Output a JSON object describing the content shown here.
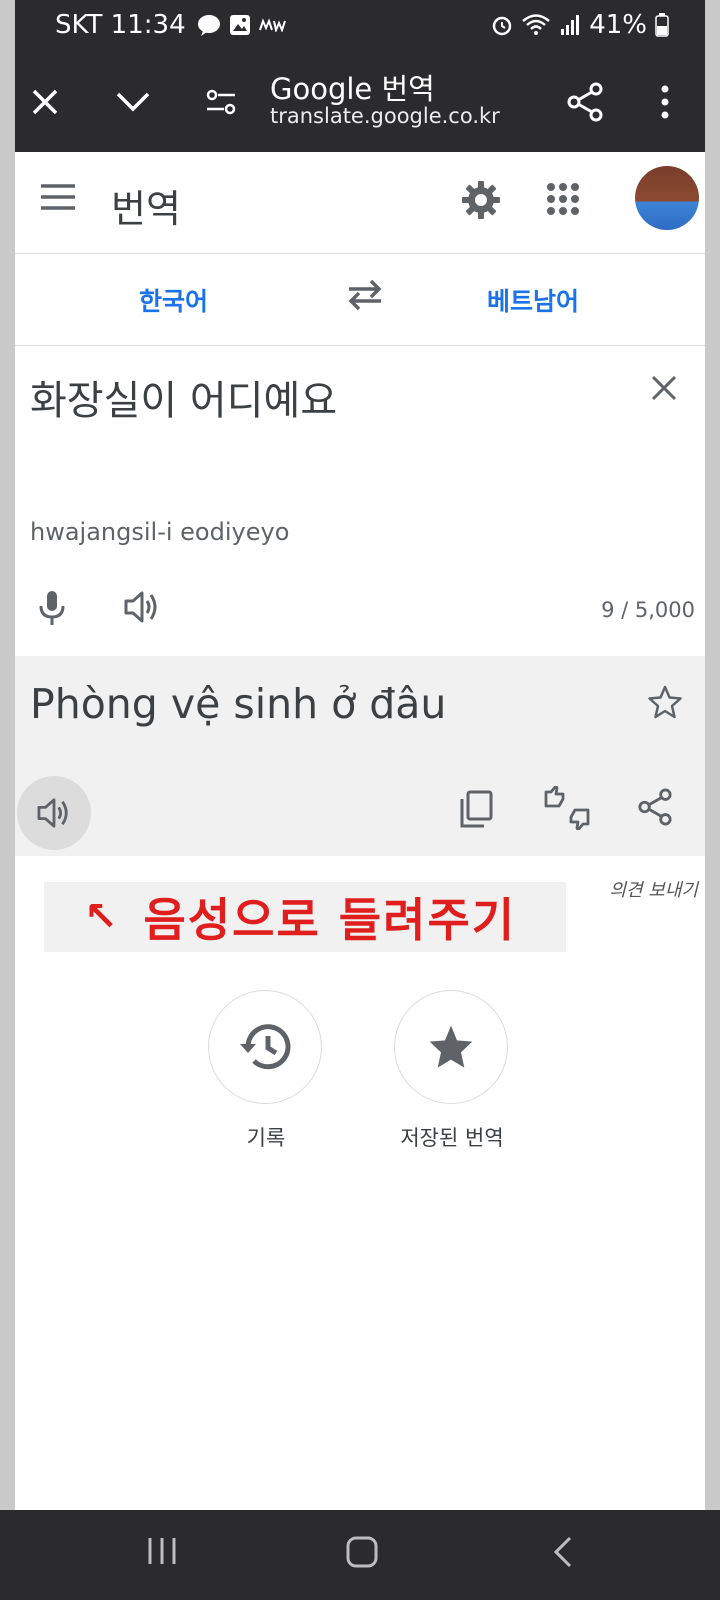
{
  "status_bar": {
    "carrier_time": "SKT 11:34",
    "battery": "41%"
  },
  "browser": {
    "title": "Google 번역",
    "url": "translate.google.co.kr"
  },
  "app": {
    "title": "번역"
  },
  "languages": {
    "source": "한국어",
    "target": "베트남어"
  },
  "input": {
    "text": "화장실이 어디예요",
    "romanization": "hwajangsil-i eodiyeyo",
    "char_count": "9 / 5,000"
  },
  "output": {
    "text": "Phòng vệ sinh ở đâu"
  },
  "feedback_link": "의견 보내기",
  "annotation": {
    "arrow": "↖",
    "text": "음성으로 들려주기"
  },
  "shortcuts": {
    "history_label": "기록",
    "saved_label": "저장된 번역"
  },
  "colors": {
    "accent": "#1a73e8",
    "annotation": "#e01e1e",
    "chrome": "#2b2b2d"
  }
}
